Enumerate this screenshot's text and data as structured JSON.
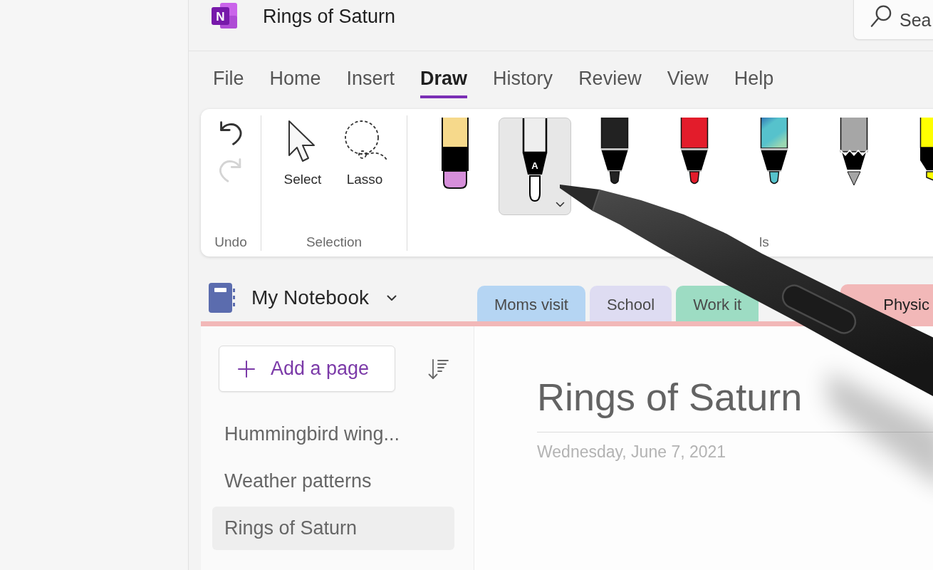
{
  "title_bar": {
    "logo_letter": "N",
    "title": "Rings of Saturn",
    "search": {
      "placeholder": "Sea"
    }
  },
  "menu": [
    {
      "label": "File",
      "selected": false
    },
    {
      "label": "Home",
      "selected": false
    },
    {
      "label": "Insert",
      "selected": false
    },
    {
      "label": "Draw",
      "selected": true
    },
    {
      "label": "History",
      "selected": false
    },
    {
      "label": "Review",
      "selected": false
    },
    {
      "label": "View",
      "selected": false
    },
    {
      "label": "Help",
      "selected": false
    }
  ],
  "ribbon": {
    "groups": [
      {
        "kind": "undo",
        "label": "Undo",
        "buttons": [
          {
            "kind": "undo",
            "disabled": false
          },
          {
            "kind": "redo",
            "disabled": true
          }
        ]
      },
      {
        "kind": "selection",
        "label": "Selection",
        "tools": [
          {
            "kind": "select",
            "label": "Select"
          },
          {
            "kind": "lasso",
            "label": "Lasso"
          }
        ]
      },
      {
        "kind": "pens",
        "label": "ls",
        "pens": [
          {
            "kind": "eraser",
            "selected": false
          },
          {
            "kind": "text_pen",
            "glyph": "A",
            "color": "#eeeeee",
            "selected": true
          },
          {
            "kind": "pen",
            "color": "#222222",
            "selected": false
          },
          {
            "kind": "pen",
            "color": "#e31c2b",
            "selected": false
          },
          {
            "kind": "galaxy_pen",
            "color": "#56c2cc",
            "selected": false
          },
          {
            "kind": "pencil",
            "color": "#a6a6a6",
            "selected": false
          },
          {
            "kind": "highlighter",
            "color": "#ffff00",
            "selected": false
          }
        ]
      }
    ]
  },
  "notebook": {
    "name": "My Notebook"
  },
  "sections": [
    {
      "label": "Moms visit",
      "color": "#b5d5f3",
      "selected": false
    },
    {
      "label": "School",
      "color": "#dedcf2",
      "selected": false
    },
    {
      "label": "Work it",
      "color": "#9ddcc3",
      "selected": false
    },
    {
      "label": "Physic",
      "color": "#f2b8b8",
      "selected": true
    }
  ],
  "page_list": {
    "add_button": "Add a page",
    "pages": [
      {
        "title": "Hummingbird wing...",
        "selected": false
      },
      {
        "title": "Weather patterns",
        "selected": false
      },
      {
        "title": "Rings of Saturn",
        "selected": true
      }
    ]
  },
  "page": {
    "title": "Rings of Saturn",
    "date": "Wednesday, June 7, 2021"
  }
}
